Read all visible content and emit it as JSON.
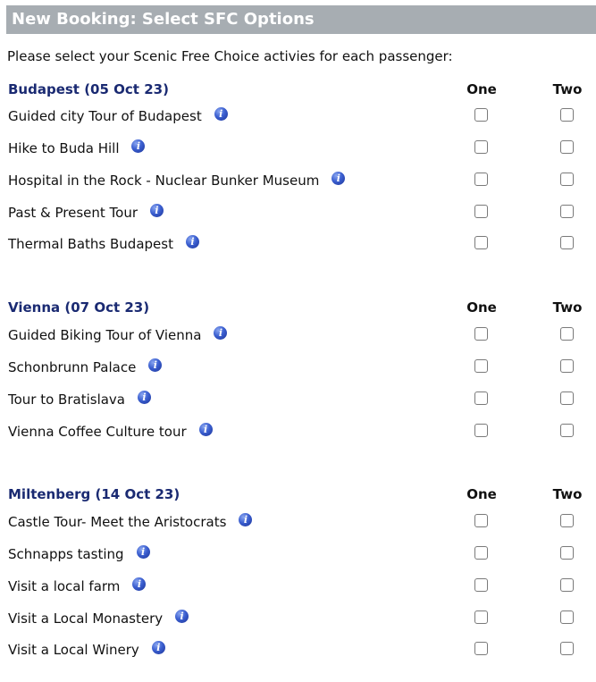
{
  "title": "New Booking:  Select SFC Options",
  "intro": "Please select your Scenic Free Choice activies for each passenger:",
  "columns": [
    "One",
    "Two"
  ],
  "info_glyph": "i",
  "sections": [
    {
      "city": "Budapest (05 Oct 23)",
      "activities": [
        "Guided city Tour of Budapest",
        "Hike to Buda Hill",
        "Hospital in the Rock - Nuclear Bunker Museum",
        "Past & Present Tour",
        "Thermal Baths Budapest"
      ]
    },
    {
      "city": "Vienna (07 Oct 23)",
      "activities": [
        "Guided Biking Tour of Vienna",
        "Schonbrunn Palace",
        "Tour to Bratislava",
        "Vienna Coffee Culture tour"
      ]
    },
    {
      "city": "Miltenberg (14 Oct 23)",
      "activities": [
        "Castle Tour- Meet the Aristocrats",
        "Schnapps tasting",
        "Visit a local farm",
        "Visit a Local Monastery",
        "Visit a Local Winery"
      ]
    }
  ]
}
